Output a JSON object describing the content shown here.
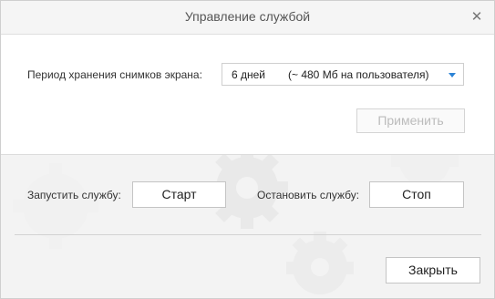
{
  "dialog": {
    "title": "Управление службой",
    "close_glyph": "✕"
  },
  "retention": {
    "label": "Период хранения снимков экрана:",
    "selected_days": "6 дней",
    "selected_size": "(~ 480 Мб на пользователя)"
  },
  "buttons": {
    "apply": "Применить",
    "start": "Старт",
    "stop": "Стоп",
    "close": "Закрыть"
  },
  "service": {
    "start_label": "Запустить службу:",
    "stop_label": "Остановить службу:"
  },
  "icons": {
    "close": "close-icon",
    "dropdown": "chevron-down-icon",
    "background": "gear-icon"
  },
  "colors": {
    "accent": "#2c83d6"
  }
}
